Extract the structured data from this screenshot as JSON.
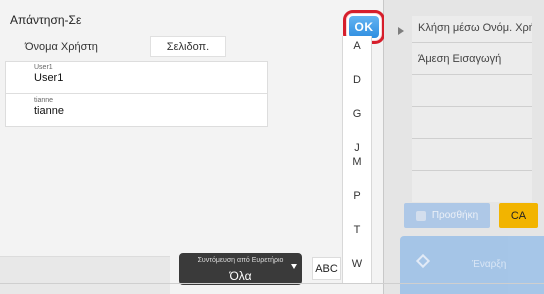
{
  "modal": {
    "title": "Απάντηση-Σε",
    "ok_label": "OK",
    "user_label": "Όνομα Χρήστη",
    "page_label": "Σελιδοπ.",
    "list": [
      {
        "small": "User1",
        "main": "User1"
      },
      {
        "small": "tianne",
        "main": "tianne"
      }
    ],
    "footer": {
      "dropdown_top": "Συντόμευση από Ευρετήριο",
      "dropdown_value": "Όλα",
      "abc_label": "ABC"
    }
  },
  "index_rail": {
    "letters": [
      "A",
      "D",
      "G",
      "J",
      "M",
      "P",
      "T",
      "W"
    ]
  },
  "right_panel": {
    "items": [
      "Κλήση μέσω Ονόμ. Χρήστη",
      "Άμεση Εισαγωγή",
      "",
      "",
      "",
      ""
    ],
    "add_label": "Προσθήκη",
    "ca_label": "CA",
    "send_label": "Έναρξη"
  },
  "colors": {
    "ok_highlight": "#d61e2b",
    "ok_fill": "#2f8ee0",
    "ca_fill": "#f2b400",
    "panel_bg": "#f3f3f3"
  }
}
